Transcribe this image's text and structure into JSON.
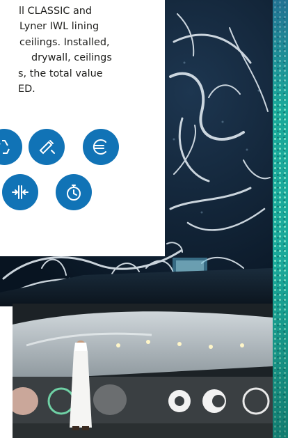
{
  "article": {
    "lines": [
      "ll CLASSIC and",
      "Lyner IWL lining",
      "ceilings. Installed,",
      "drywall, ceilings",
      "s, the total value",
      "ED."
    ]
  },
  "icons": [
    {
      "name": "recycle-icon",
      "color": "#1173b6"
    },
    {
      "name": "tools-icon",
      "color": "#1173b6"
    },
    {
      "name": "euro-icon",
      "color": "#1173b6"
    },
    {
      "name": "width-compress-icon",
      "color": "#1173b6"
    },
    {
      "name": "stopwatch-icon",
      "color": "#1173b6"
    }
  ],
  "colors": {
    "accent_blue": "#1173b6",
    "band_teal": "#1aa99a",
    "text": "#1d1d1b"
  }
}
